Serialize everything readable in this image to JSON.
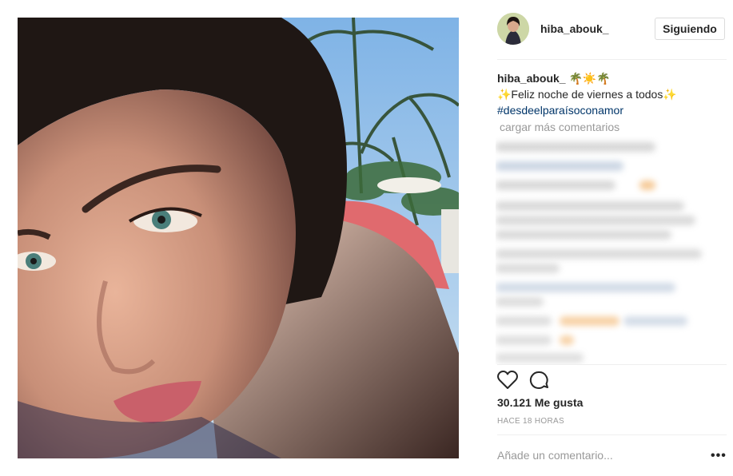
{
  "post": {
    "username": "hiba_abouk_",
    "follow_button": "Siguiendo",
    "caption_user": "hiba_abouk_",
    "caption_emoji": "🌴☀️🌴",
    "caption_text": "✨Feliz noche de viernes a todos✨",
    "hashtag": "#desdeelparaísoconamor",
    "load_more": "cargar más comentarios",
    "likes": "30.121 Me gusta",
    "timestamp": "HACE 18 HORAS",
    "comment_placeholder": "Añade un comentario...",
    "more_options": "•••"
  },
  "icons": {
    "like": "heart-icon",
    "comment": "comment-icon",
    "more": "more-options-icon"
  },
  "colors": {
    "hashtag": "#003569",
    "muted": "#999999",
    "text": "#262626"
  }
}
